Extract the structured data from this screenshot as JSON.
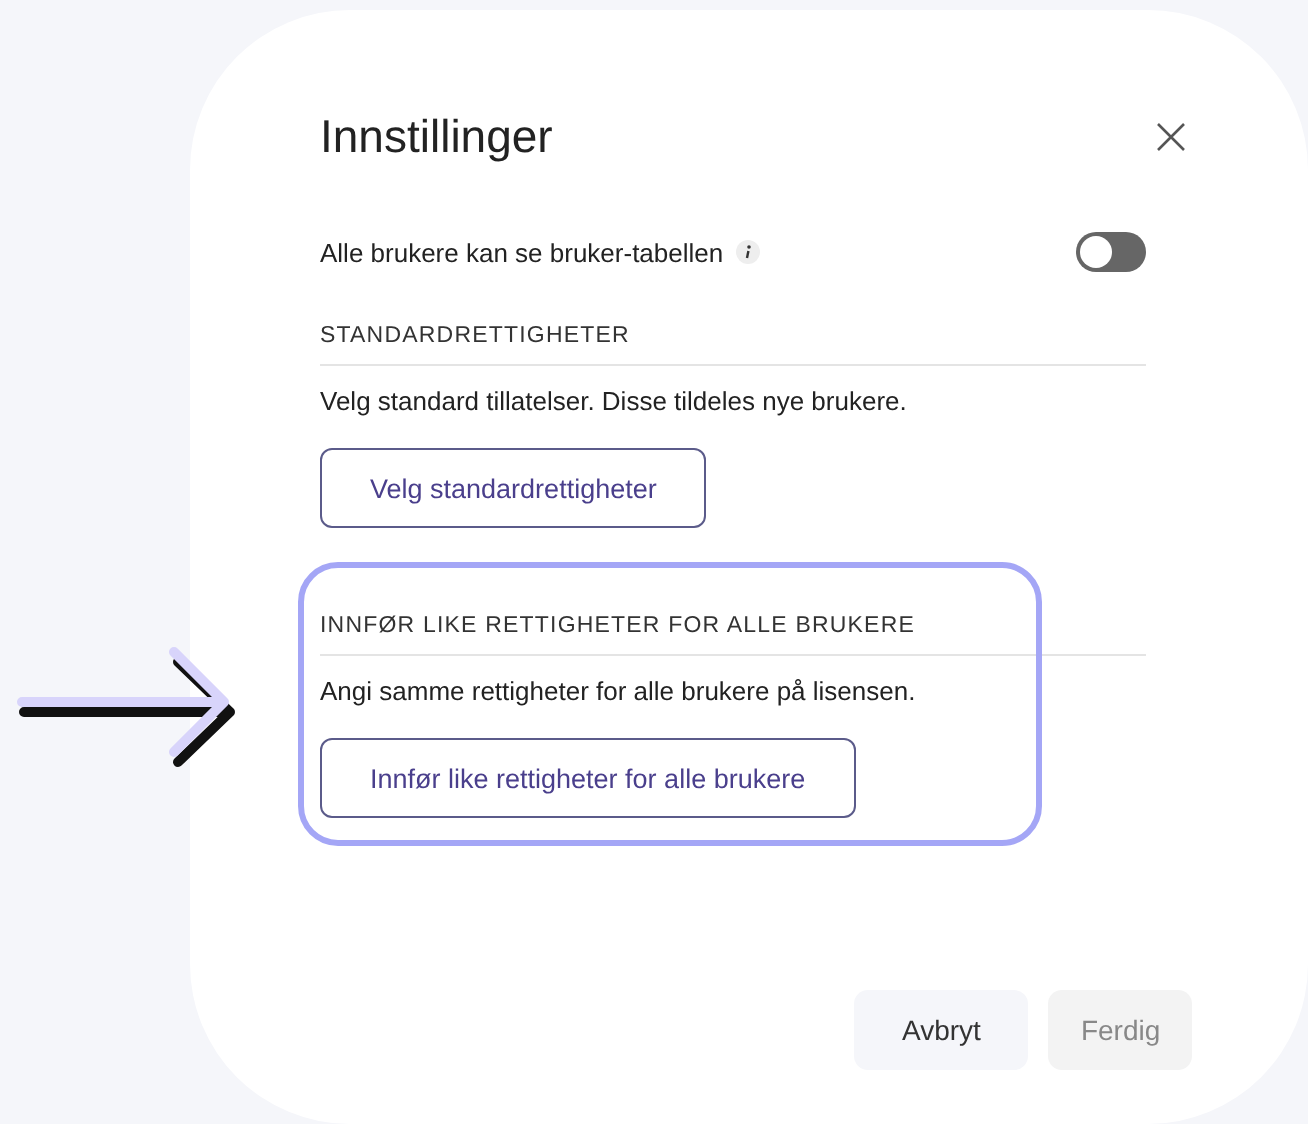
{
  "dialog": {
    "title": "Innstillinger"
  },
  "setting": {
    "label": "Alle brukere kan se bruker-tabellen",
    "on": false
  },
  "sections": [
    {
      "heading": "STANDARDRETTIGHETER",
      "description": "Velg standard tillatelser. Disse tildeles nye brukere.",
      "button": "Velg standardrettigheter",
      "highlighted": false
    },
    {
      "heading": "INNFØR LIKE RETTIGHETER FOR ALLE BRUKERE",
      "description": "Angi samme rettigheter for alle brukere på lisensen.",
      "button": "Innfør like rettigheter for alle brukere",
      "highlighted": true
    }
  ],
  "footer_buttons": [
    {
      "label": "Avbryt",
      "disabled": false
    },
    {
      "label": "Ferdig",
      "disabled": true
    }
  ]
}
